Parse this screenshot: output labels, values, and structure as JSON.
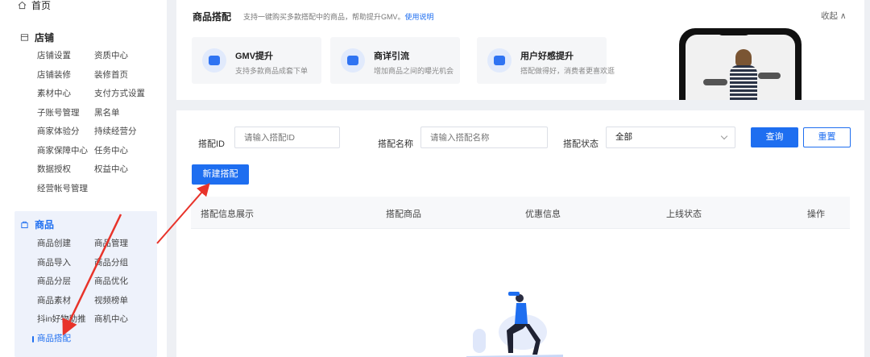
{
  "sidebar": {
    "home": "首页",
    "store": {
      "title": "店铺",
      "items": [
        "店铺设置",
        "资质中心",
        "店铺装修",
        "装修首页",
        "素材中心",
        "支付方式设置",
        "子账号管理",
        "黑名单",
        "商家体验分",
        "持续经营分",
        "商家保障中心",
        "任务中心",
        "数据授权",
        "权益中心",
        "经营帐号管理"
      ]
    },
    "goods": {
      "title": "商品",
      "items": [
        "商品创建",
        "商品管理",
        "商品导入",
        "商品分组",
        "商品分层",
        "商品优化",
        "商品素材",
        "视频榜单",
        "抖in好物助推",
        "商机中心",
        "商品搭配"
      ]
    }
  },
  "intro": {
    "title": "商品搭配",
    "subtitle": "支持一键购买多款搭配中的商品，帮助提升GMV。",
    "help_link": "使用说明",
    "collapse": "收起 ∧",
    "features": [
      {
        "title": "GMV提升",
        "desc": "支持多款商品成套下单"
      },
      {
        "title": "商详引流",
        "desc": "增加商品之间的曝光机会"
      },
      {
        "title": "用户好感提升",
        "desc": "搭配做得好，消费者更喜欢逛"
      }
    ]
  },
  "filters": {
    "id_label": "搭配ID",
    "id_placeholder": "请输入搭配ID",
    "name_label": "搭配名称",
    "name_placeholder": "请输入搭配名称",
    "status_label": "搭配状态",
    "status_value": "全部",
    "search": "查询",
    "reset": "重置"
  },
  "new_button": "新建搭配",
  "table": {
    "headers": [
      "搭配信息展示",
      "搭配商品",
      "优惠信息",
      "上线状态",
      "操作"
    ]
  },
  "colors": {
    "accent": "#1e6ef0",
    "arrow": "#e8332a"
  }
}
